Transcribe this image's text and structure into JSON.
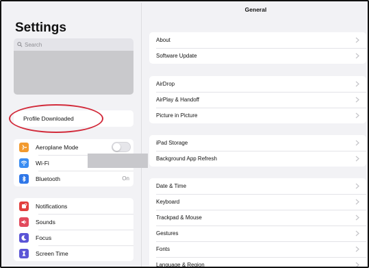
{
  "sidebar": {
    "title": "Settings",
    "search": {
      "placeholder": "Search"
    },
    "profile": {
      "label": "Profile Downloaded"
    },
    "group1": [
      {
        "label": "Aeroplane Mode",
        "icon": "airplane-icon",
        "color": "#f29a2e",
        "control": "toggle",
        "toggle_on": false
      },
      {
        "label": "Wi-Fi",
        "icon": "wifi-icon",
        "color": "#3a8df2",
        "control": ""
      },
      {
        "label": "Bluetooth",
        "icon": "bluetooth-icon",
        "color": "#2f77e8",
        "value": "On"
      }
    ],
    "group2": [
      {
        "label": "Notifications",
        "icon": "bell-icon",
        "color": "#e2403e"
      },
      {
        "label": "Sounds",
        "icon": "speaker-icon",
        "color": "#e24a5c"
      },
      {
        "label": "Focus",
        "icon": "moon-icon",
        "color": "#5b55d6"
      },
      {
        "label": "Screen Time",
        "icon": "hourglass-icon",
        "color": "#5b55d6"
      }
    ]
  },
  "main": {
    "title": "General",
    "groups": [
      [
        "About",
        "Software Update"
      ],
      [
        "AirDrop",
        "AirPlay & Handoff",
        "Picture in Picture"
      ],
      [
        "iPad Storage",
        "Background App Refresh"
      ],
      [
        "Date & Time",
        "Keyboard",
        "Trackpad & Mouse",
        "Gestures",
        "Fonts",
        "Language & Region"
      ]
    ]
  },
  "colors": {
    "annotation_circle": "#d22a3a",
    "background": "#f2f2f5"
  }
}
